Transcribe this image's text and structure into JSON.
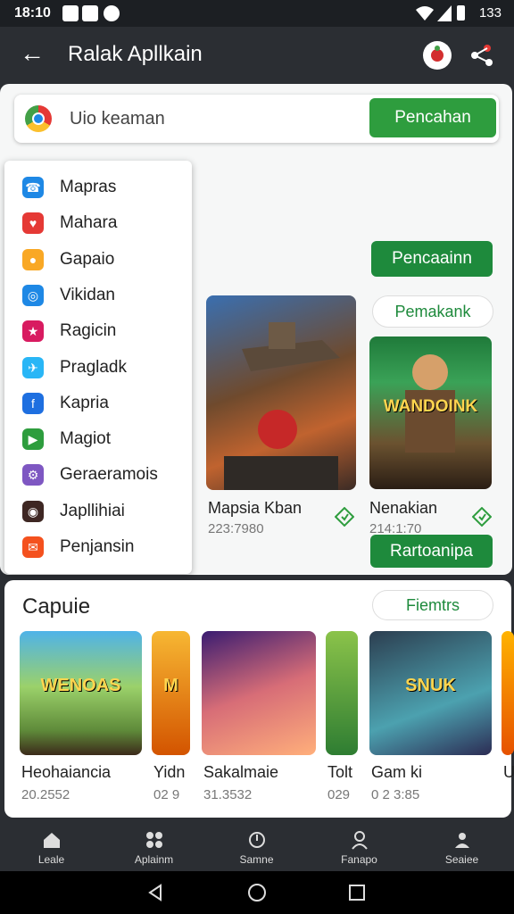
{
  "status_bar": {
    "time": "18:10",
    "battery": "133"
  },
  "app_bar": {
    "title": "Ralak Apllkain"
  },
  "search": {
    "text": "Uio keaman",
    "button": "Pencahan"
  },
  "menu": [
    {
      "label": "Mapras",
      "icon": "phone-icon",
      "color": "#1e88e5"
    },
    {
      "label": "Mahara",
      "icon": "heart-icon",
      "color": "#e53935"
    },
    {
      "label": "Gapaio",
      "icon": "person-icon",
      "color": "#f9a825"
    },
    {
      "label": "Vikidan",
      "icon": "circle-icon",
      "color": "#1e88e5"
    },
    {
      "label": "Ragicin",
      "icon": "star-icon",
      "color": "#d81b60"
    },
    {
      "label": "Pragladk",
      "icon": "bird-icon",
      "color": "#29b6f6"
    },
    {
      "label": "Kapria",
      "icon": "f-icon",
      "color": "#1e6fe0"
    },
    {
      "label": "Magiot",
      "icon": "play-icon",
      "color": "#2e9d3e"
    },
    {
      "label": "Geraeramois",
      "icon": "gear-icon",
      "color": "#7e57c2"
    },
    {
      "label": "Japllihiai",
      "icon": "camera-icon",
      "color": "#3e2723"
    },
    {
      "label": "Penjansin",
      "icon": "mail-icon",
      "color": "#f4511e"
    }
  ],
  "main": {
    "button1": "Pencaainn",
    "tab_button": "Pemakank",
    "featured": [
      {
        "name": "Mapsia Kban",
        "sub": "223:7980"
      },
      {
        "name": "Nenakian",
        "sub": "214:1:70",
        "cover_text": "WANDOINK"
      }
    ],
    "action_button": "Rartoanipa"
  },
  "section": {
    "title": "Capuie",
    "filter_button": "Fiemtrs",
    "games": [
      {
        "name": "Heohaiancia",
        "sub": "20.2552",
        "cover_text": "WENOAS"
      },
      {
        "name": "Yidn",
        "sub": "02 9",
        "cover_text": "M"
      },
      {
        "name": "Sakalmaie",
        "sub": "31.3532"
      },
      {
        "name": "Tolt",
        "sub": "029"
      },
      {
        "name": "Gam ki",
        "sub": "0 2 3:85",
        "cover_text": "SNUK"
      },
      {
        "name": "U",
        "sub": ""
      }
    ]
  },
  "bottom_nav": [
    {
      "label": "Leale",
      "icon": "home-icon"
    },
    {
      "label": "Aplainm",
      "icon": "apps-icon"
    },
    {
      "label": "Samne",
      "icon": "game-icon"
    },
    {
      "label": "Fanapo",
      "icon": "person-icon"
    },
    {
      "label": "Seaiee",
      "icon": "account-icon"
    }
  ]
}
